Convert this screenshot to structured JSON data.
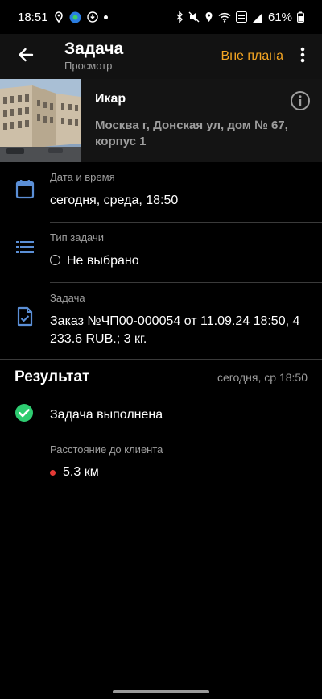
{
  "status_bar": {
    "time": "18:51",
    "battery": "61%"
  },
  "app_bar": {
    "title": "Задача",
    "subtitle": "Просмотр",
    "action_label": "Вне плана",
    "icons": {
      "back": "arrow-left-icon",
      "more": "more-vertical-icon"
    }
  },
  "client": {
    "name": "Икар",
    "address": "Москва г, Донская ул, дом № 67, корпус 1",
    "icons": {
      "info": "info-icon"
    }
  },
  "datetime": {
    "label": "Дата и время",
    "value": "сегодня, среда, 18:50",
    "icon": "calendar-icon"
  },
  "task_type": {
    "label": "Тип задачи",
    "value": "Не выбрано",
    "icon": "list-icon"
  },
  "task": {
    "label": "Задача",
    "value": "Заказ №ЧП00-000054 от 11.09.24 18:50, 4 233.6 RUB.; 3 кг.",
    "icon": "document-check-icon"
  },
  "result": {
    "title": "Результат",
    "time": "сегодня, ср 18:50",
    "status_text": "Задача выполнена",
    "status_icon": "check-circle-icon",
    "distance_label": "Расстояние до клиента",
    "distance_value": "5.3 км"
  },
  "colors": {
    "accent": "#f5a623",
    "icon_blue": "#5b8fd6",
    "success": "#2ecc71",
    "danger": "#e53935"
  }
}
